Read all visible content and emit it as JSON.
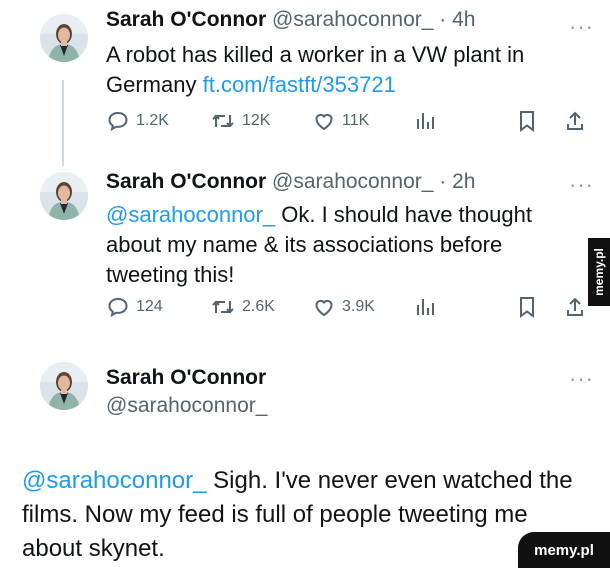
{
  "tweets": [
    {
      "name": "Sarah O'Connor",
      "handle": "@sarahoconnor_",
      "time": "· 4h",
      "text": "A robot has killed a worker in a VW plant in Germany",
      "link": "ft.com/fastft/353721",
      "replies": "1.2K",
      "retweets": "12K",
      "likes": "11K"
    },
    {
      "name": "Sarah O'Connor",
      "handle": "@sarahoconnor_",
      "time": "· 2h",
      "mention": "@sarahoconnor_",
      "text": "Ok. I should have thought about my name & its associations before tweeting this!",
      "replies": "124",
      "retweets": "2.6K",
      "likes": "3.9K"
    },
    {
      "name": "Sarah O'Connor",
      "handle": "@sarahoconnor_",
      "mention": "@sarahoconnor_",
      "text": "Sigh. I've never even watched the films. Now my feed is full of people tweeting me about skynet."
    }
  ],
  "more_glyph": "···",
  "icons": [
    "reply-icon",
    "retweet-icon",
    "like-icon",
    "views-icon",
    "bookmark-icon",
    "share-icon",
    "more-icon"
  ],
  "watermark": "memy.pl",
  "colors": {
    "link": "#1d9bf0",
    "muted": "#536471",
    "thread_line": "#cfd9de"
  }
}
